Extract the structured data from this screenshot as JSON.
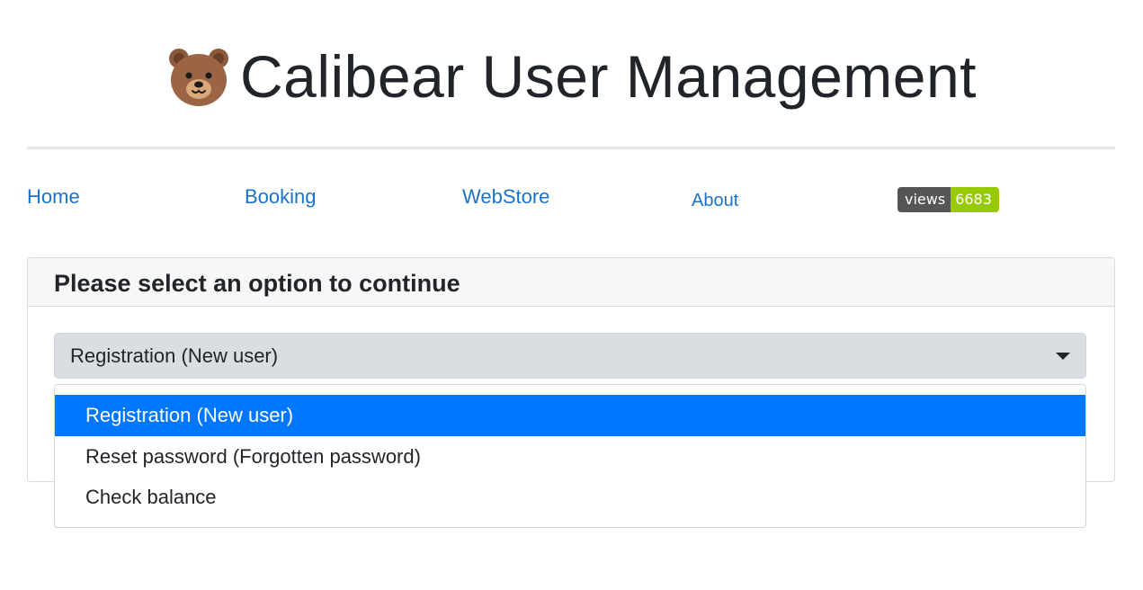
{
  "header": {
    "title": "Calibear User Management",
    "icon": "bear-face-icon"
  },
  "nav": {
    "items": [
      {
        "label": "Home"
      },
      {
        "label": "Booking"
      },
      {
        "label": "WebStore"
      },
      {
        "label": "About"
      }
    ],
    "badge": {
      "label": "views",
      "value": "6683"
    }
  },
  "card": {
    "title": "Please select an option to continue"
  },
  "select": {
    "value": "Registration (New user)",
    "options": [
      {
        "label": "Registration (New user)",
        "selected": true
      },
      {
        "label": "Reset password (Forgotten password)",
        "selected": false
      },
      {
        "label": "Check balance",
        "selected": false
      }
    ]
  },
  "colors": {
    "link": "#1a73c8",
    "highlight": "#0077ff",
    "badge_label_bg": "#555555",
    "badge_value_bg": "#97ca00",
    "select_bg": "#dadee3"
  }
}
